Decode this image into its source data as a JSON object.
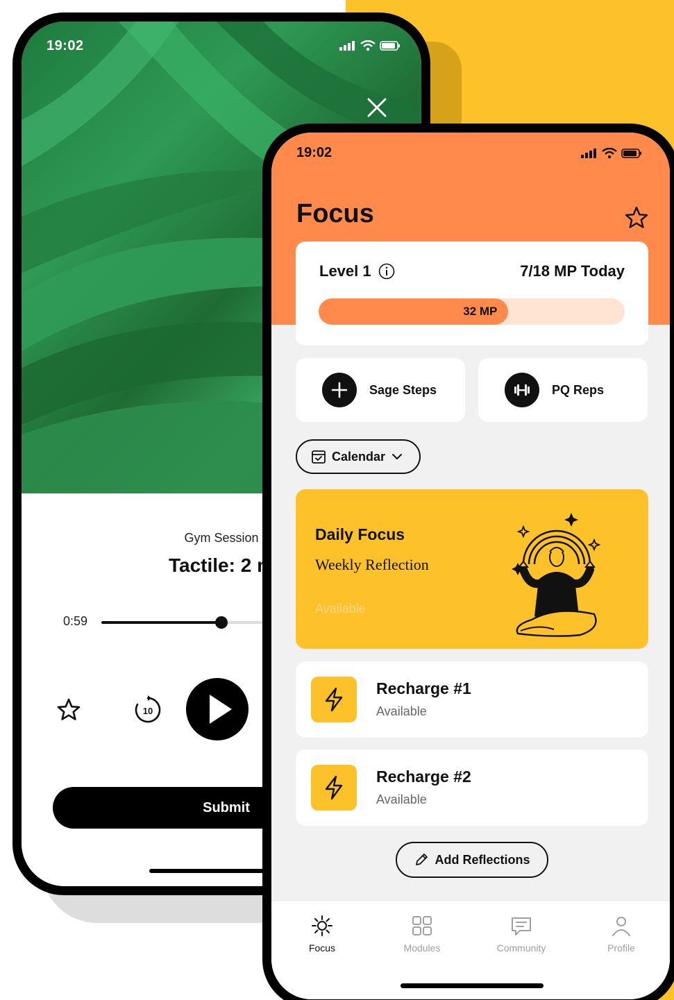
{
  "colors": {
    "brand_orange": "#ff8a4c",
    "brand_yellow": "#fdc12a",
    "page_background_accent": "#fdc12a",
    "tab_active": "#111111",
    "tab_inactive": "#a0a0a0"
  },
  "player_screen": {
    "status_time": "19:02",
    "close_icon": "close-icon",
    "session_label": "Gym Session",
    "track_title": "Tactile: 2 m",
    "elapsed_time": "0:59",
    "progress_fraction": 0.48,
    "replay_seconds": "10",
    "submit_label": "Submit"
  },
  "focus_screen": {
    "status_time": "19:02",
    "title": "Focus",
    "level_label": "Level 1",
    "mp_today": "7/18 MP Today",
    "mp_total_label": "32 MP",
    "mp_progress_fraction": 0.62,
    "quick_actions": [
      {
        "label": "Sage Steps",
        "icon": "plus-icon"
      },
      {
        "label": "PQ Reps",
        "icon": "dumbbell-icon"
      }
    ],
    "calendar_label": "Calendar",
    "daily_focus": {
      "title": "Daily Focus",
      "subtitle": "Weekly Reflection",
      "status": "Available"
    },
    "recharges": [
      {
        "title": "Recharge #1",
        "status": "Available"
      },
      {
        "title": "Recharge #2",
        "status": "Available"
      }
    ],
    "add_reflections_label": "Add Reflections",
    "tabs": [
      {
        "label": "Focus",
        "icon": "sun-icon",
        "active": true
      },
      {
        "label": "Modules",
        "icon": "grid-icon",
        "active": false
      },
      {
        "label": "Community",
        "icon": "chat-icon",
        "active": false
      },
      {
        "label": "Profile",
        "icon": "person-icon",
        "active": false
      }
    ]
  }
}
